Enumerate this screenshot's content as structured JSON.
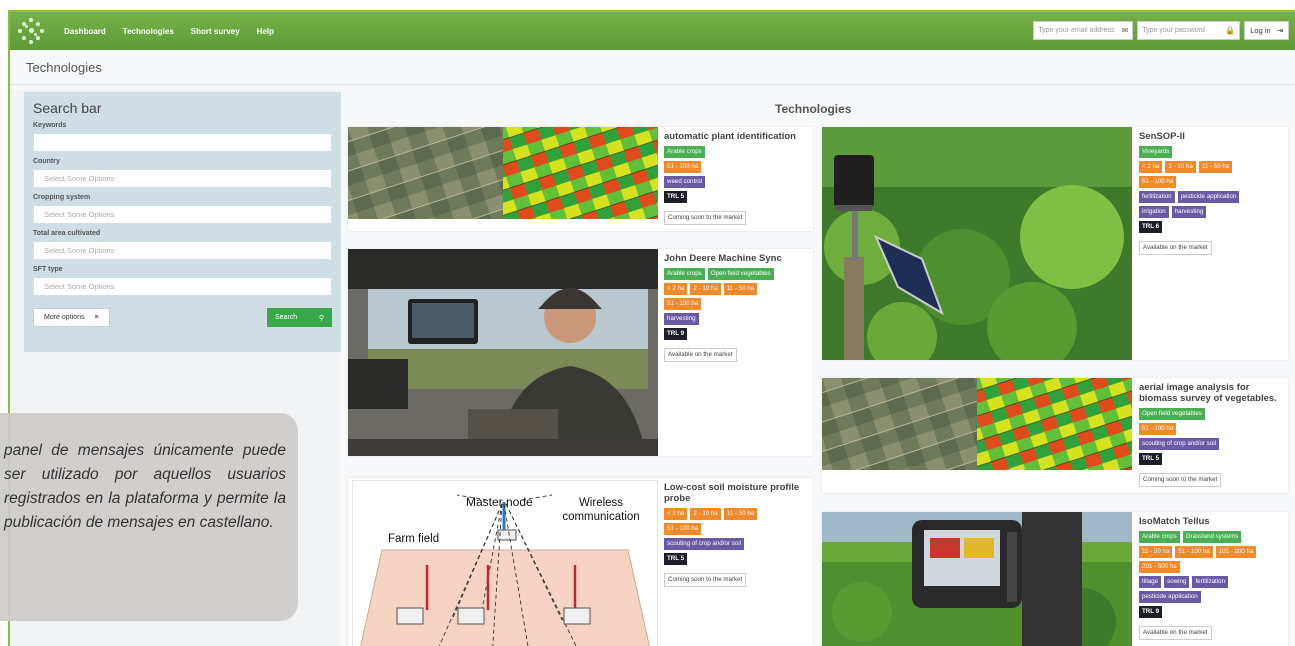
{
  "nav": {
    "links": [
      "Dashboard",
      "Technologies",
      "Short survey",
      "Help"
    ],
    "email_placeholder": "Type your email address",
    "password_placeholder": "Type your password",
    "login_label": "Log in"
  },
  "page_title": "Technologies",
  "search": {
    "title": "Search bar",
    "keywords_label": "Keywords",
    "country_label": "Country",
    "cropping_label": "Cropping system",
    "area_label": "Total area cultivated",
    "sft_label": "SFT type",
    "select_placeholder": "Select Some Options",
    "more_options_label": "More options",
    "search_label": "Search"
  },
  "main_title": "Technologies",
  "cards": [
    {
      "title": "automatic plant identification",
      "tags": [
        [
          "Arable crops"
        ],
        [
          "51 - 100 ha"
        ],
        [
          "weed control"
        ]
      ],
      "trl": "TRL 5",
      "status": "Coming soon to the market"
    },
    {
      "title": "John Deere Machine Sync",
      "tags": [
        [
          "Arable crops",
          "Open field vegetables"
        ],
        [
          "< 2 ha",
          "2 - 10 ha",
          "11 - 50 ha"
        ],
        [
          "51 - 100 ha"
        ],
        [
          "harvesting"
        ]
      ],
      "trl": "TRL 9",
      "status": "Available on the market"
    },
    {
      "title": "Low-cost soil moisture profile probe",
      "tags": [
        [
          "< 2 ha",
          "2 - 10 ha",
          "11 - 50 ha"
        ],
        [
          "51 - 100 ha"
        ],
        [
          "scouting of crop and/or soil"
        ]
      ],
      "trl": "TRL 5",
      "status": "Coming soon to the market"
    },
    {
      "title": "SenSOP-II",
      "tags": [
        [
          "Vineyards"
        ],
        [
          "< 2 ha",
          "2 - 10 ha",
          "11 - 50 ha"
        ],
        [
          "51 - 100 ha"
        ],
        [
          "fertilization",
          "pesticide application"
        ],
        [
          "irrigation",
          "harvesting"
        ]
      ],
      "trl": "TRL 6",
      "status": "Available on the market"
    },
    {
      "title": "aerial image analysis for biomass survey of vegetables.",
      "tags": [
        [
          "Open field vegetables"
        ],
        [
          "51 - 100 ha"
        ],
        [
          "scouting of crop and/or soil"
        ]
      ],
      "trl": "TRL 5",
      "status": "Coming soon to the market"
    },
    {
      "title": "IsoMatch Tellus",
      "tags": [
        [
          "Arable crops",
          "Grassland systems"
        ],
        [
          "11 - 50 ha",
          "51 - 100 ha",
          "101 - 200 ha"
        ],
        [
          "201 - 500 ha"
        ],
        [
          "tillage",
          "sowing",
          "fertilization"
        ],
        [
          "pesticide application"
        ]
      ],
      "trl": "TRL 9",
      "status": "Available on the market"
    }
  ],
  "diagram": {
    "master": "Master node",
    "wireless": "Wireless communication",
    "field": "Farm field"
  },
  "overlay_text": "panel de mensajes únicamente puede ser utilizado por aquellos usuarios registrados en la plataforma y permite la publicación de mensajes en castellano.",
  "colors": {
    "nav_green": "#6aa83f",
    "tag_green": "#4aae54",
    "tag_orange": "#f08a2b",
    "tag_purple": "#6a5aa6",
    "tag_trl": "#1c1f28",
    "search_panel": "#cfdde4"
  }
}
